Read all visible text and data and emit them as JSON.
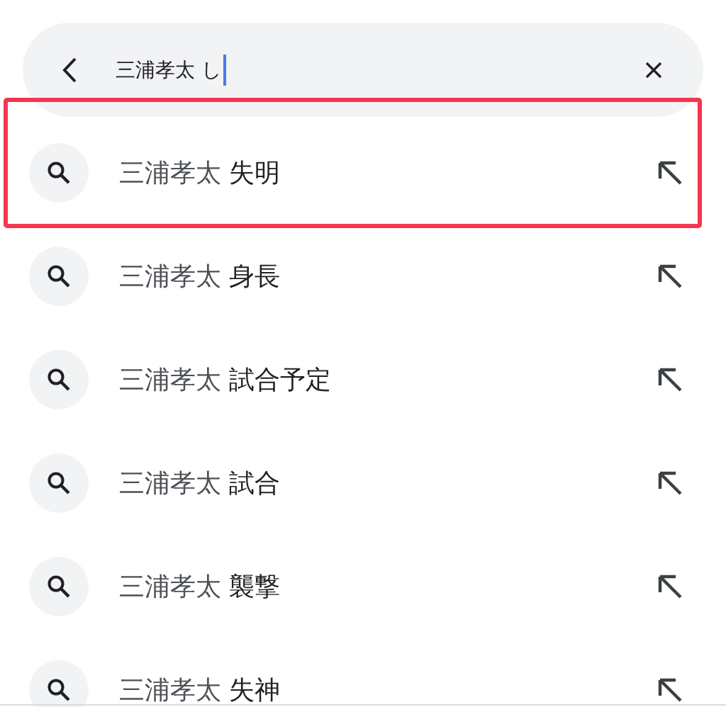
{
  "search_bar": {
    "value": "三浦孝太 し",
    "focused": true
  },
  "suggestions": [
    {
      "text": "三浦孝太 **失明**",
      "highlighted": true
    },
    {
      "text": "三浦孝太 **身長**",
      "highlighted": false
    },
    {
      "text": "三浦孝太 **試合予定**",
      "highlighted": false
    },
    {
      "text": "三浦孝太 **試合**",
      "highlighted": false
    },
    {
      "text": "三浦孝太 **襲撃**",
      "highlighted": false
    },
    {
      "text": "三浦孝太 **失神**",
      "highlighted": false
    }
  ]
}
